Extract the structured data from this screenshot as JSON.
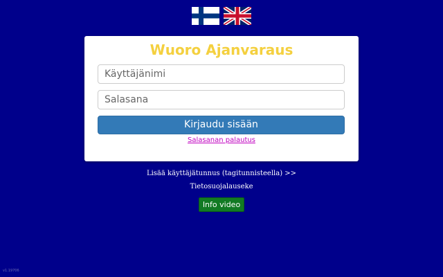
{
  "languages": {
    "finnish_flag": "finnish-flag-icon",
    "english_flag": "uk-flag-icon"
  },
  "login": {
    "title": "Wuoro Ajanvaraus",
    "username_placeholder": "Käyttäjänimi",
    "password_placeholder": "Salasana",
    "submit_label": "Kirjaudu sisään",
    "reset_link": "Salasanan palautus"
  },
  "links": {
    "add_user": "Lisää käyttäjätunnus (tagitunnisteella) >>",
    "privacy": "Tietosuojalauseke"
  },
  "info_button": "Info video",
  "version": "v1.19706",
  "colors": {
    "background": "#00008b",
    "title": "#f4d03f",
    "primary_button": "#337ab7",
    "info_button": "#127a23",
    "reset_link": "#c000c0"
  }
}
